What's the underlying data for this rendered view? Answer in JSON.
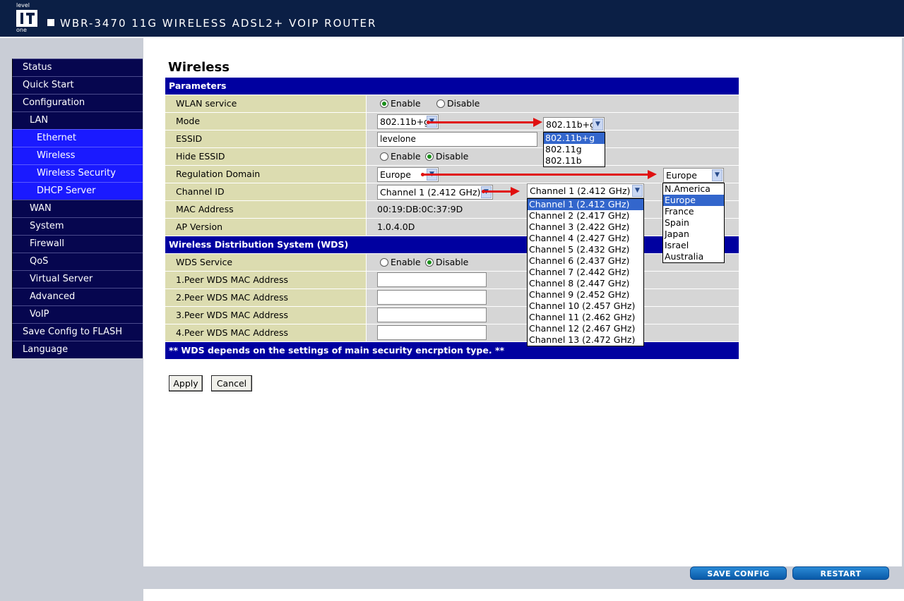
{
  "header": {
    "logo_top": "level",
    "logo_bottom": "one",
    "title": "WBR-3470 11G WIRELESS ADSL2+ VOIP ROUTER"
  },
  "sidebar": {
    "items": [
      {
        "label": "Status",
        "level": 0
      },
      {
        "label": "Quick Start",
        "level": 0
      },
      {
        "label": "Configuration",
        "level": 0
      },
      {
        "label": "LAN",
        "level": 1
      },
      {
        "label": "Ethernet",
        "level": 2
      },
      {
        "label": "Wireless",
        "level": 2
      },
      {
        "label": "Wireless Security",
        "level": 2
      },
      {
        "label": "DHCP Server",
        "level": 2
      },
      {
        "label": "WAN",
        "level": 1
      },
      {
        "label": "System",
        "level": 1
      },
      {
        "label": "Firewall",
        "level": 1
      },
      {
        "label": "QoS",
        "level": 1
      },
      {
        "label": "Virtual Server",
        "level": 1
      },
      {
        "label": "Advanced",
        "level": 1
      },
      {
        "label": "VoIP",
        "level": 1
      },
      {
        "label": "Save Config to FLASH",
        "level": 0
      },
      {
        "label": "Language",
        "level": 0
      }
    ]
  },
  "main": {
    "title": "Wireless",
    "parameters_header": "Parameters",
    "wlan_service": {
      "label": "WLAN service",
      "enable": "Enable",
      "disable": "Disable",
      "selected": "Enable"
    },
    "mode": {
      "label": "Mode",
      "value": "802.11b+g",
      "options": [
        "802.11b+g",
        "802.11g",
        "802.11b"
      ],
      "highlighted": "802.11b+g"
    },
    "essid": {
      "label": "ESSID",
      "value": "levelone"
    },
    "hide_essid": {
      "label": "Hide ESSID",
      "enable": "Enable",
      "disable": "Disable",
      "selected": "Disable"
    },
    "regulation_domain": {
      "label": "Regulation Domain",
      "value": "Europe",
      "options": [
        "N.America",
        "Europe",
        "France",
        "Spain",
        "Japan",
        "Israel",
        "Australia"
      ],
      "highlighted": "Europe"
    },
    "channel_id": {
      "label": "Channel ID",
      "value": "Channel 1 (2.412 GHz)",
      "options": [
        "Channel 1 (2.412 GHz)",
        "Channel 2 (2.417 GHz)",
        "Channel 3 (2.422 GHz)",
        "Channel 4 (2.427 GHz)",
        "Channel 5 (2.432 GHz)",
        "Channel 6 (2.437 GHz)",
        "Channel 7 (2.442 GHz)",
        "Channel 8 (2.447 GHz)",
        "Channel 9 (2.452 GHz)",
        "Channel 10 (2.457 GHz)",
        "Channel 11 (2.462 GHz)",
        "Channel 12 (2.467 GHz)",
        "Channel 13 (2.472 GHz)"
      ],
      "highlighted": "Channel 1 (2.412 GHz)"
    },
    "mac_address": {
      "label": "MAC Address",
      "value": "00:19:DB:0C:37:9D"
    },
    "ap_version": {
      "label": "AP Version",
      "value": "1.0.4.0D"
    },
    "wds_header": "Wireless Distribution System (WDS)",
    "wds_service": {
      "label": "WDS Service",
      "enable": "Enable",
      "disable": "Disable",
      "selected": "Disable"
    },
    "peers": [
      {
        "label": "1.Peer WDS MAC Address",
        "value": ""
      },
      {
        "label": "2.Peer WDS MAC Address",
        "value": ""
      },
      {
        "label": "3.Peer WDS MAC Address",
        "value": ""
      },
      {
        "label": "4.Peer WDS MAC Address",
        "value": ""
      }
    ],
    "wds_note": "** WDS depends on the settings of main security encrption type. **",
    "apply_label": "Apply",
    "cancel_label": "Cancel"
  },
  "footer": {
    "save_config_label": "SAVE CONFIG",
    "restart_label": "RESTART"
  },
  "colors": {
    "header_bg": "#0b1f45",
    "nav_bg": "#06064f",
    "nav_sub_bg": "#1a1aff",
    "section_bg": "#0000a0",
    "label_bg": "#dcdcb0",
    "value_bg": "#d6d6d6",
    "annotation_arrow": "#e01010"
  }
}
